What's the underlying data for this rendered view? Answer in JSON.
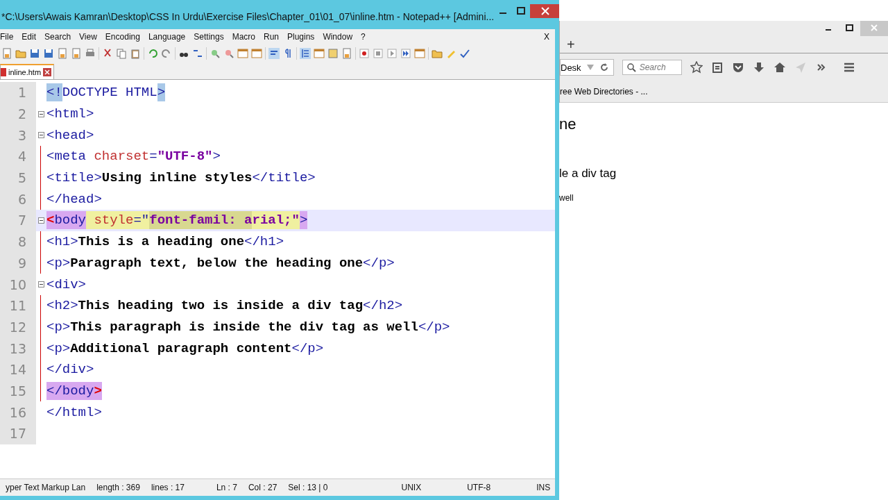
{
  "editor_window": {
    "title": "*C:\\Users\\Awais Kamran\\Desktop\\CSS In Urdu\\Exercise Files\\Chapter_01\\01_07\\inline.htm - Notepad++ [Admini...",
    "menu": [
      "File",
      "Edit",
      "Search",
      "View",
      "Encoding",
      "Language",
      "Settings",
      "Macro",
      "Run",
      "Plugins",
      "Window",
      "?"
    ],
    "menu_close": "X",
    "tabs": [
      {
        "label": "inline.htm",
        "selected": true
      }
    ],
    "lines": [
      {
        "number": "1",
        "fold": false,
        "current": false,
        "tokens": [
          {
            "text": "<!",
            "kind": "tag",
            "color": "#a8c8e8"
          },
          {
            "text": "DOCTYPE HTML",
            "kind": "tag"
          },
          {
            "text": ">",
            "kind": "tag",
            "color": "#a8c8e8"
          }
        ]
      },
      {
        "number": "2",
        "fold": true,
        "current": false,
        "tokens": [
          {
            "text": "<html>",
            "kind": "tag"
          }
        ]
      },
      {
        "number": "3",
        "fold": true,
        "current": false,
        "tokens": [
          {
            "text": "<head>",
            "kind": "tag"
          }
        ]
      },
      {
        "number": "4",
        "fold": false,
        "current": false,
        "tokens": [
          {
            "text": "<meta ",
            "kind": "tag"
          },
          {
            "text": "charset",
            "kind": "attr"
          },
          {
            "text": "=",
            "kind": "tag"
          },
          {
            "text": "\"UTF-8\"",
            "kind": "value"
          },
          {
            "text": ">",
            "kind": "tag"
          }
        ]
      },
      {
        "number": "5",
        "fold": false,
        "current": false,
        "tokens": [
          {
            "text": "<title>",
            "kind": "tag"
          },
          {
            "text": "Using inline styles",
            "kind": "text"
          },
          {
            "text": "</title>",
            "kind": "tag"
          }
        ]
      },
      {
        "number": "6",
        "fold": false,
        "current": false,
        "tokens": [
          {
            "text": "</head>",
            "kind": "tag"
          }
        ]
      },
      {
        "number": "7",
        "fold": true,
        "current": true,
        "tokens": [
          {
            "text": "<",
            "kind": "bracket",
            "color": "#d8a8f0"
          },
          {
            "text": "body",
            "kind": "tag",
            "color": "#d8a8f0"
          },
          {
            "text": " style",
            "kind": "attr",
            "color": "#f0f0a0"
          },
          {
            "text": "=\"",
            "kind": "tag",
            "color": "#f0f0a0"
          },
          {
            "text": "font-famil: a",
            "kind": "value",
            "color": "#d8d890"
          },
          {
            "text": "rial;\"",
            "kind": "value",
            "color": "#f0f0a0"
          },
          {
            "text": ">",
            "kind": "tag",
            "color": "#d8a8f0"
          }
        ]
      },
      {
        "number": "8",
        "fold": false,
        "current": false,
        "tokens": [
          {
            "text": "<h1>",
            "kind": "tag"
          },
          {
            "text": "This is a heading one",
            "kind": "text"
          },
          {
            "text": "</h1>",
            "kind": "tag"
          }
        ]
      },
      {
        "number": "9",
        "fold": false,
        "current": false,
        "tokens": [
          {
            "text": "<p>",
            "kind": "tag"
          },
          {
            "text": "Paragraph text, below the heading one",
            "kind": "text"
          },
          {
            "text": "</p>",
            "kind": "tag"
          }
        ]
      },
      {
        "number": "10",
        "fold": true,
        "current": false,
        "tokens": [
          {
            "text": "<div>",
            "kind": "tag"
          }
        ]
      },
      {
        "number": "11",
        "fold": false,
        "current": false,
        "tokens": [
          {
            "text": "<h2>",
            "kind": "tag"
          },
          {
            "text": "This heading two is inside a div tag",
            "kind": "text"
          },
          {
            "text": "</h2>",
            "kind": "tag"
          }
        ]
      },
      {
        "number": "12",
        "fold": false,
        "current": false,
        "tokens": [
          {
            "text": "<p>",
            "kind": "tag"
          },
          {
            "text": "This paragraph is inside the div tag as well",
            "kind": "text"
          },
          {
            "text": "</p>",
            "kind": "tag"
          }
        ]
      },
      {
        "number": "13",
        "fold": false,
        "current": false,
        "tokens": [
          {
            "text": "<p>",
            "kind": "tag"
          },
          {
            "text": "Additional paragraph content",
            "kind": "text"
          },
          {
            "text": "</p>",
            "kind": "tag"
          }
        ]
      },
      {
        "number": "14",
        "fold": false,
        "current": false,
        "tokens": [
          {
            "text": "</div>",
            "kind": "tag"
          }
        ]
      },
      {
        "number": "15",
        "fold": false,
        "current": false,
        "tokens": [
          {
            "text": "</body",
            "kind": "tag",
            "color": "#d8a8f0"
          },
          {
            "text": ">",
            "kind": "bracket",
            "color": "#d8a8f0"
          }
        ]
      },
      {
        "number": "16",
        "fold": false,
        "current": false,
        "tokens": [
          {
            "text": "</html>",
            "kind": "tag"
          }
        ]
      },
      {
        "number": "17",
        "fold": false,
        "current": false
      }
    ],
    "status_bar": [
      "yper Text Markup Lan",
      "length : 369",
      "lines : 17",
      "Ln : 7",
      "Col : 27",
      "Sel : 13 | 0",
      "UNIX",
      "UTF-8",
      "INS"
    ]
  },
  "browser_window": {
    "new_tab": "+",
    "address": "Desk",
    "search": {
      "placeholder": "Search"
    },
    "bookmark": "ree Web Directories - ...",
    "page": [
      {
        "text": "ne",
        "kind": "heading1"
      },
      {
        "text": "le a div tag",
        "kind": "heading2"
      },
      {
        "text": "well",
        "kind": "paragraph"
      }
    ]
  }
}
